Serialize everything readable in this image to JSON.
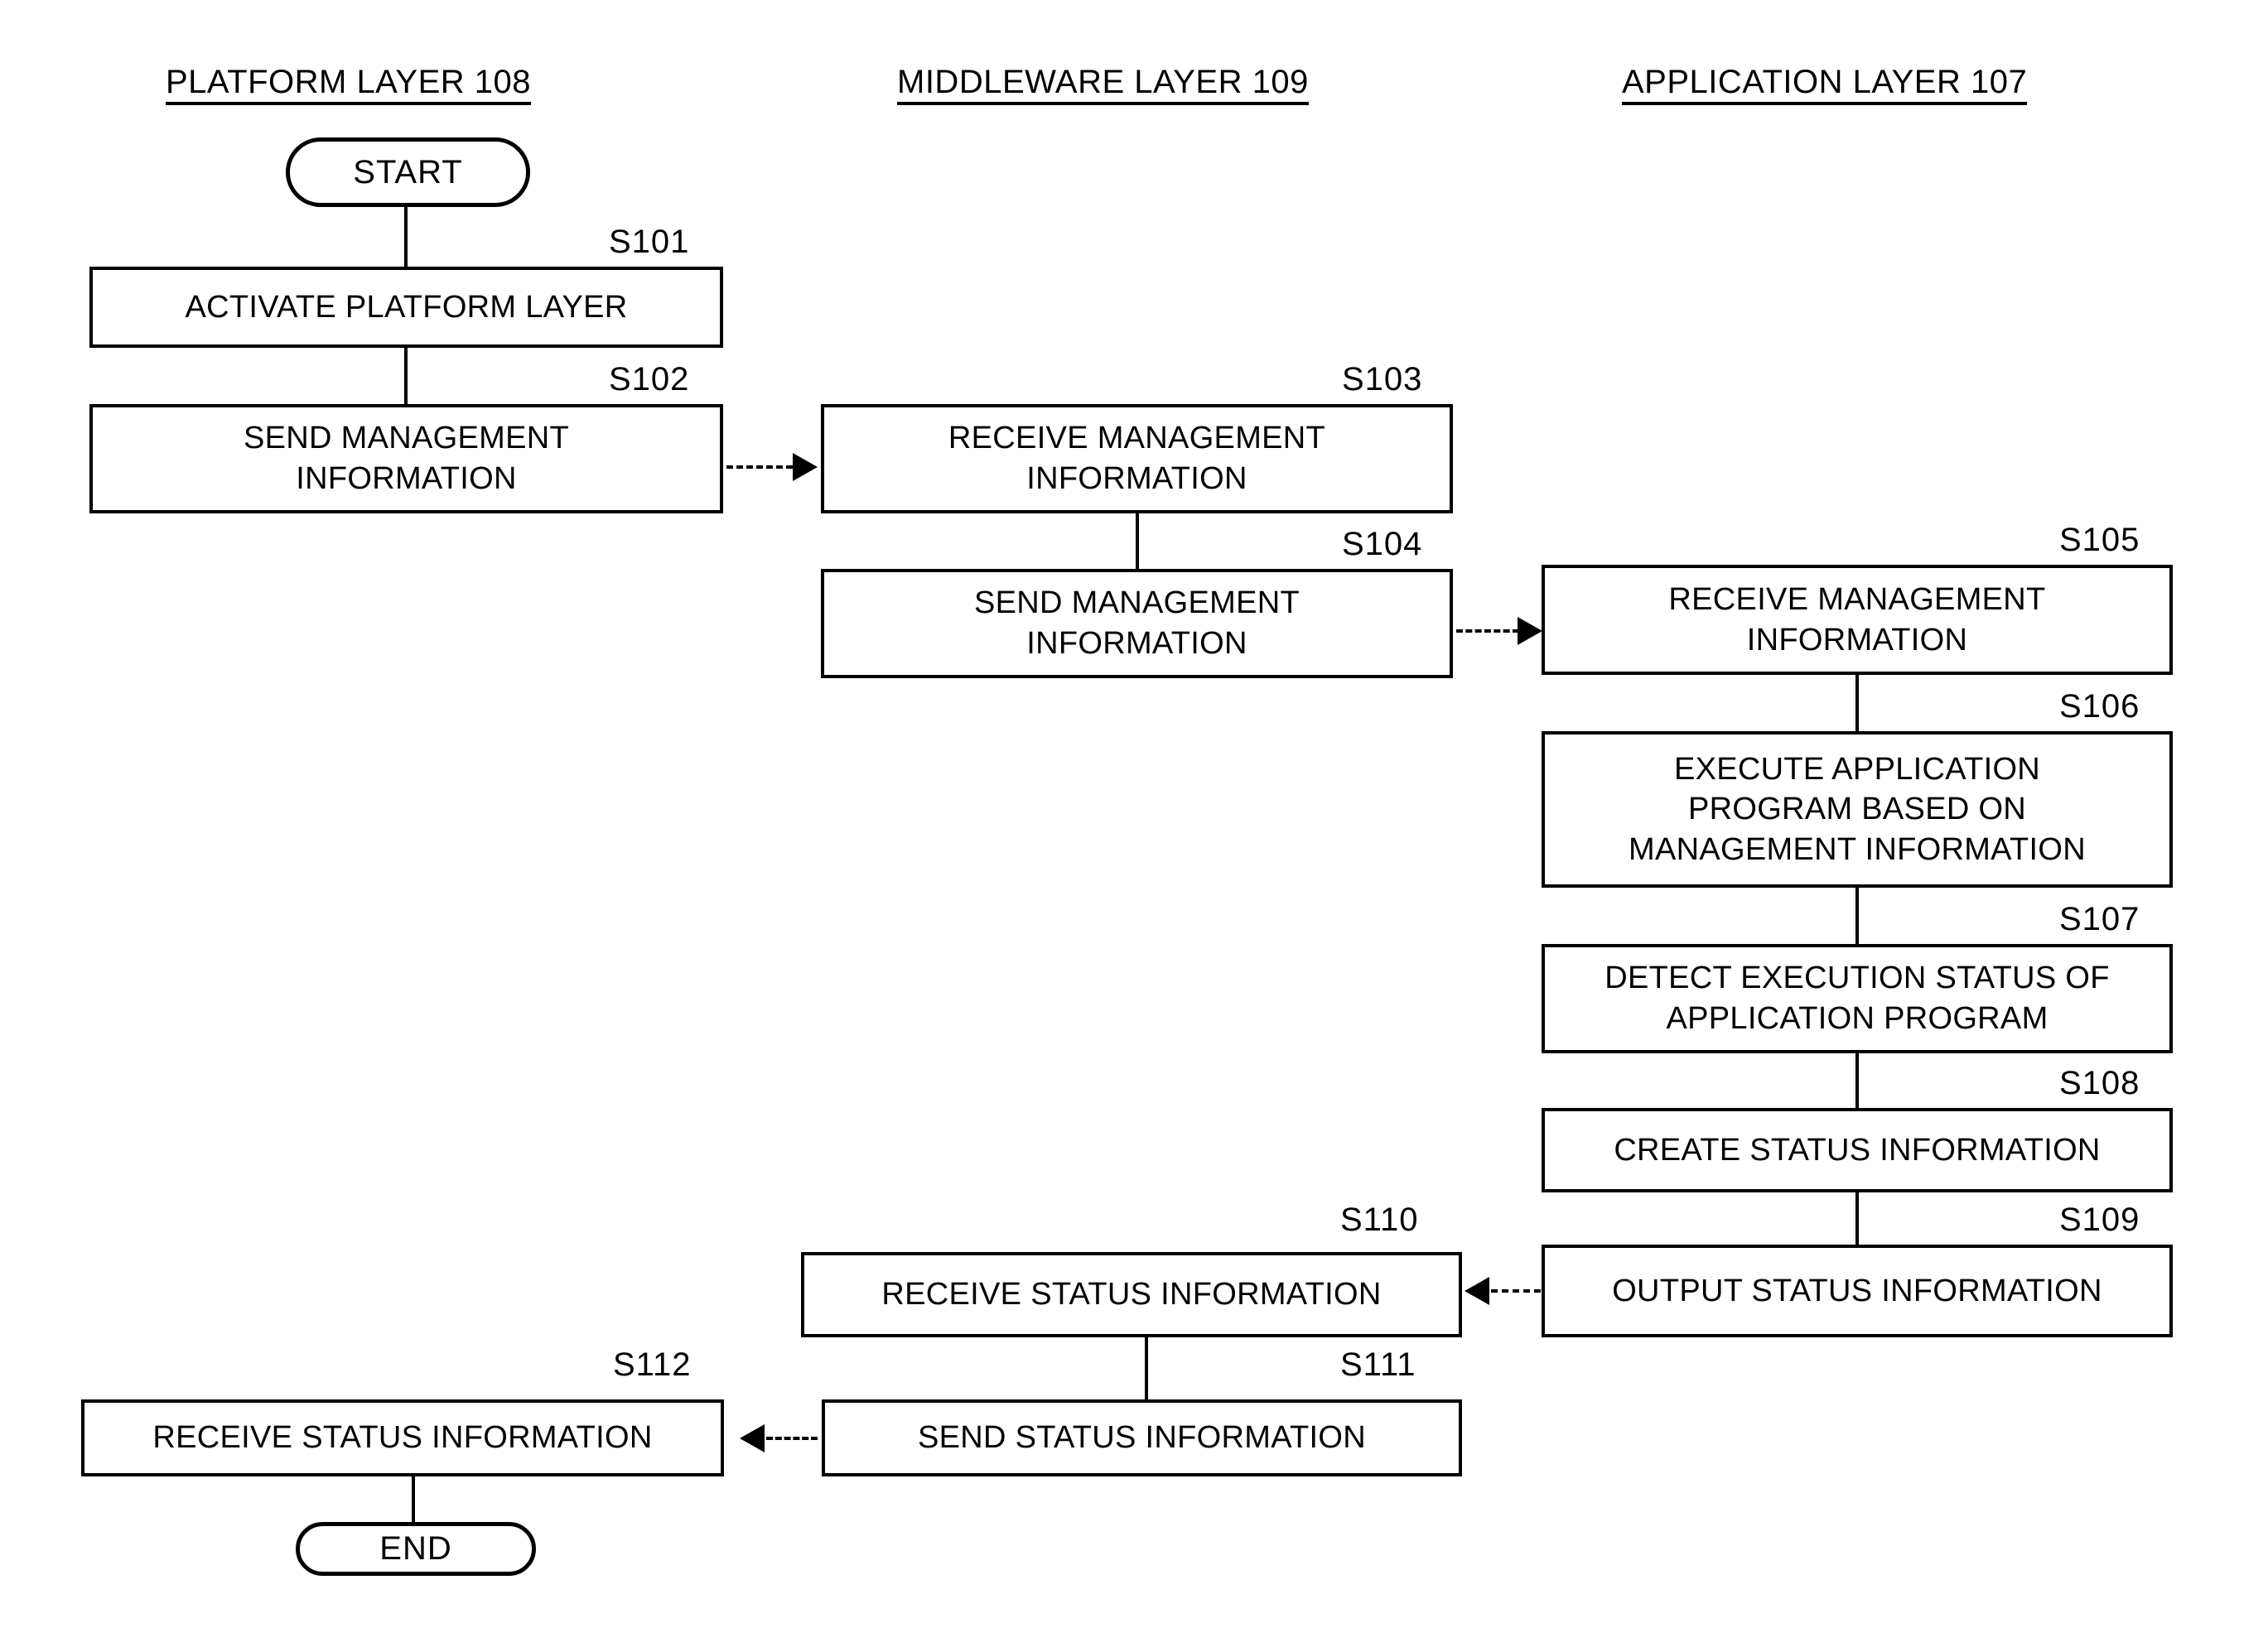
{
  "figure": {
    "type": "flowchart",
    "columns": [
      {
        "id": "platform",
        "title": "PLATFORM LAYER 108"
      },
      {
        "id": "middleware",
        "title": "MIDDLEWARE LAYER 109"
      },
      {
        "id": "application",
        "title": "APPLICATION LAYER 107"
      }
    ],
    "terminators": {
      "start": "START",
      "end": "END"
    },
    "steps": [
      {
        "id": "S101",
        "label": "S101",
        "column": "platform",
        "text": "ACTIVATE PLATFORM LAYER"
      },
      {
        "id": "S102",
        "label": "S102",
        "column": "platform",
        "line1": "SEND MANAGEMENT",
        "line2": "INFORMATION"
      },
      {
        "id": "S103",
        "label": "S103",
        "column": "middleware",
        "line1": "RECEIVE MANAGEMENT",
        "line2": "INFORMATION"
      },
      {
        "id": "S104",
        "label": "S104",
        "column": "middleware",
        "line1": "SEND MANAGEMENT",
        "line2": "INFORMATION"
      },
      {
        "id": "S105",
        "label": "S105",
        "column": "application",
        "line1": "RECEIVE MANAGEMENT",
        "line2": "INFORMATION"
      },
      {
        "id": "S106",
        "label": "S106",
        "column": "application",
        "line1": "EXECUTE APPLICATION",
        "line2": "PROGRAM BASED ON",
        "line3": "MANAGEMENT INFORMATION"
      },
      {
        "id": "S107",
        "label": "S107",
        "column": "application",
        "line1": "DETECT EXECUTION STATUS OF",
        "line2": "APPLICATION PROGRAM"
      },
      {
        "id": "S108",
        "label": "S108",
        "column": "application",
        "text": "CREATE STATUS INFORMATION"
      },
      {
        "id": "S109",
        "label": "S109",
        "column": "application",
        "text": "OUTPUT STATUS INFORMATION"
      },
      {
        "id": "S110",
        "label": "S110",
        "column": "middleware",
        "text": "RECEIVE STATUS INFORMATION"
      },
      {
        "id": "S111",
        "label": "S111",
        "column": "middleware",
        "text": "SEND STATUS INFORMATION"
      },
      {
        "id": "S112",
        "label": "S112",
        "column": "platform",
        "text": "RECEIVE STATUS INFORMATION"
      }
    ],
    "colors": {
      "stroke": "#000000",
      "background": "#ffffff"
    }
  }
}
